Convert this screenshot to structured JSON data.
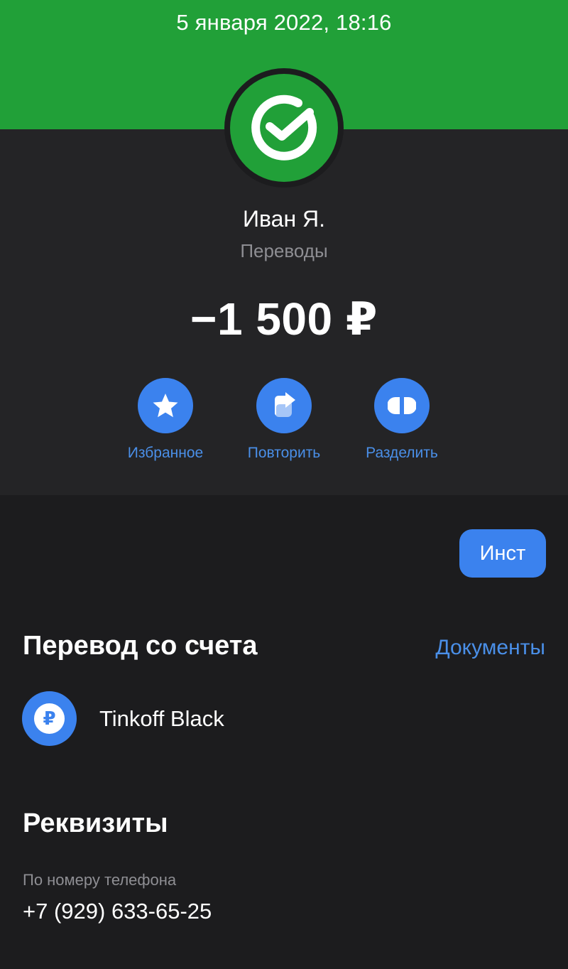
{
  "header": {
    "datetime": "5 января 2022, 18:16",
    "background_color": "#21a038"
  },
  "logo": {
    "icon": "sber-check-icon",
    "color": "#21a038"
  },
  "transaction": {
    "recipient": "Иван Я.",
    "category": "Переводы",
    "amount": "−1 500 ₽"
  },
  "actions": [
    {
      "label": "Избранное",
      "icon": "star-icon"
    },
    {
      "label": "Повторить",
      "icon": "repeat-arrow-icon"
    },
    {
      "label": "Разделить",
      "icon": "split-icon"
    }
  ],
  "tag": {
    "label": "Инст"
  },
  "source_section": {
    "title": "Перевод со счета",
    "documents_link": "Документы",
    "account": {
      "icon_symbol": "₽",
      "name": "Tinkoff Black"
    }
  },
  "details_section": {
    "title": "Реквизиты",
    "field_label": "По номеру телефона",
    "field_value": "+7 (929) 633-65-25"
  },
  "colors": {
    "accent_blue": "#3b82ee",
    "link_blue": "#4a8fe8",
    "background": "#1c1c1e",
    "panel": "#242426",
    "secondary_text": "#8e8e93"
  }
}
